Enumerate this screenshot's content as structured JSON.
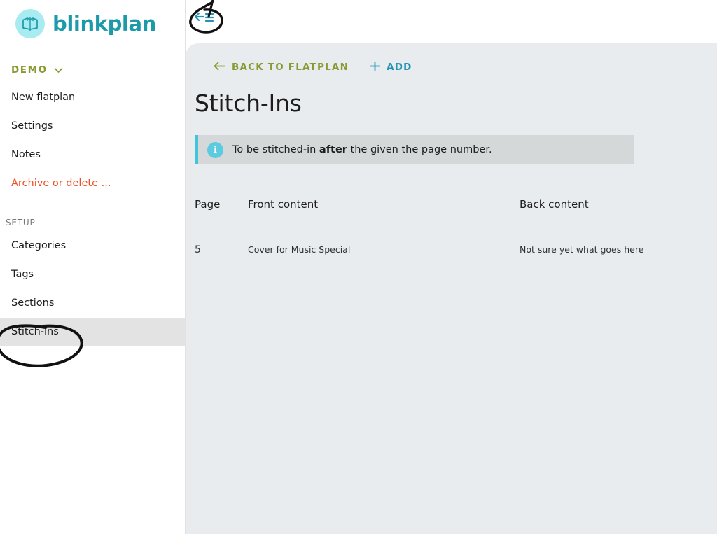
{
  "brand": {
    "name": "blinkplan",
    "logo_icon": "open-book-icon",
    "logo_bg": "#a8ecf2",
    "logo_stroke": "#1b9aaa",
    "text_color": "#1b9aaa"
  },
  "sidebar": {
    "workspace": {
      "label": "DEMO",
      "chevron_icon": "chevron-down-icon",
      "color": "#8a9a33"
    },
    "items": [
      {
        "label": "New flatplan",
        "name": "new-flatplan",
        "style": "normal",
        "active": false
      },
      {
        "label": "Settings",
        "name": "settings",
        "style": "normal",
        "active": false
      },
      {
        "label": "Notes",
        "name": "notes",
        "style": "normal",
        "active": false
      },
      {
        "label": "Archive or delete ...",
        "name": "archive-or-delete",
        "style": "danger",
        "active": false
      }
    ],
    "group_title": "SETUP",
    "setup_items": [
      {
        "label": "Categories",
        "name": "categories",
        "active": false
      },
      {
        "label": "Tags",
        "name": "tags",
        "active": false
      },
      {
        "label": "Sections",
        "name": "sections",
        "active": false
      },
      {
        "label": "Stitch-ins",
        "name": "stitch-ins",
        "active": true
      }
    ],
    "danger_color": "#f04e23",
    "active_bg": "#e3e3e3"
  },
  "topbar": {
    "collapse_icon": "collapse-sidebar-icon",
    "collapse_icon_color": "#2195b3"
  },
  "toolbar": {
    "back_label": "BACK TO FLATPLAN",
    "back_icon": "arrow-left-icon",
    "back_color": "#8a9a33",
    "add_label": "ADD",
    "add_icon": "plus-icon",
    "add_color": "#2195b3"
  },
  "main": {
    "page_title": "Stitch-Ins",
    "background": "#e9ecef"
  },
  "info_banner": {
    "icon": "info-icon",
    "accent_color": "#41c5dd",
    "background": "#d4d8d9",
    "text_before": "To be stitched-in ",
    "text_bold": "after",
    "text_after": " the given the page number."
  },
  "table": {
    "columns": [
      "Page",
      "Front content",
      "Back content"
    ],
    "rows": [
      {
        "page": "5",
        "front": "Cover for Music Special",
        "back": "Not sure yet what goes here"
      }
    ]
  },
  "annotations": [
    {
      "name": "circle-around-collapse-icon",
      "shape": "hand-drawn-ellipse",
      "color": "#111111"
    },
    {
      "name": "circle-around-stitch-ins",
      "shape": "hand-drawn-ellipse",
      "color": "#111111"
    }
  ]
}
